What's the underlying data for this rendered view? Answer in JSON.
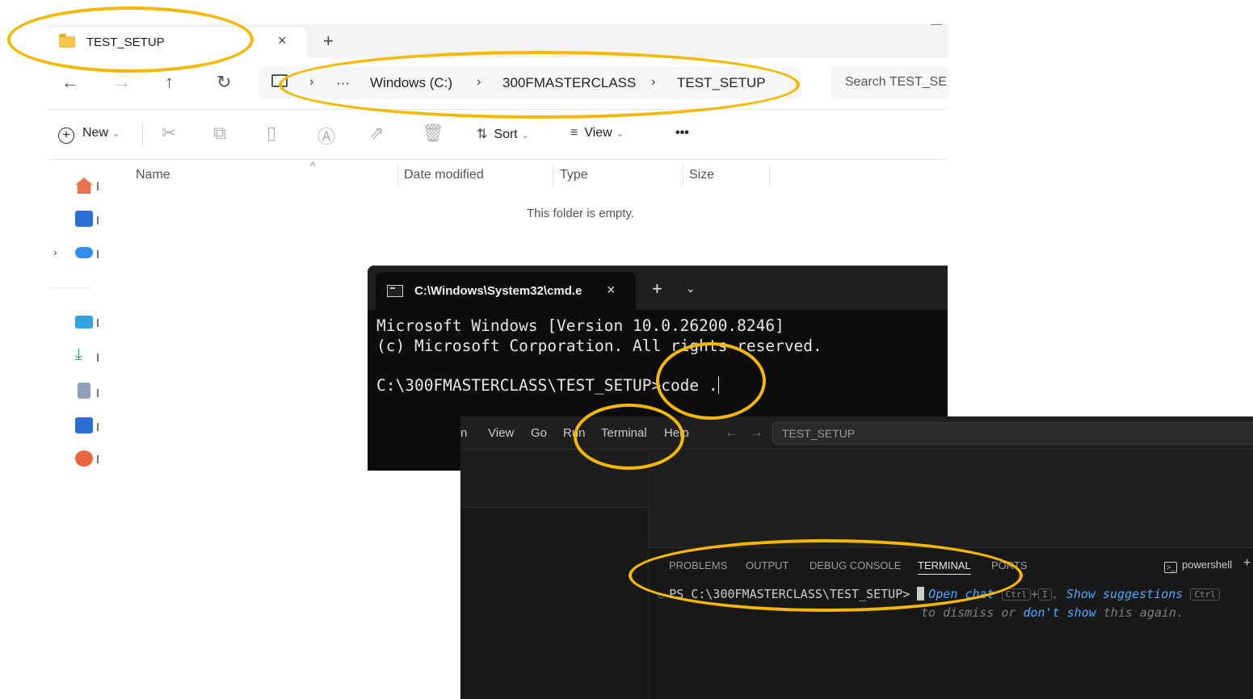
{
  "explorer": {
    "tab_title": "TEST_SETUP",
    "tab_close": "×",
    "new_tab": "+",
    "nav": {
      "back": "←",
      "forward": "→",
      "up": "↑",
      "refresh": "↻"
    },
    "breadcrumb": {
      "overflow": "···",
      "separator": "›",
      "items": [
        "Windows (C:)",
        "300FMASTERCLASS",
        "TEST_SETUP"
      ]
    },
    "search_placeholder": "Search TEST_SE",
    "commands": {
      "new_label": "New",
      "sort_label": "Sort",
      "view_label": "View",
      "more": "•••",
      "icons": [
        "cut-icon",
        "copy-icon",
        "paste-icon",
        "rename-icon",
        "share-icon",
        "delete-icon"
      ]
    },
    "columns": [
      "Name",
      "Date modified",
      "Type",
      "Size"
    ],
    "empty_message": "This folder is empty."
  },
  "cmd": {
    "tab_title": "C:\\Windows\\System32\\cmd.e",
    "tab_close": "×",
    "new_tab": "+",
    "dropdown": "⌄",
    "lines": [
      "Microsoft Windows [Version 10.0.26200.8246]",
      "(c) Microsoft Corporation. All rights reserved.",
      "C:\\300FMASTERCLASS\\TEST_SETUP>code ."
    ]
  },
  "vscode": {
    "menu": [
      "n",
      "View",
      "Go",
      "Run",
      "Terminal",
      "Help"
    ],
    "nav": {
      "back": "←",
      "forward": "→"
    },
    "command_center": "TEST_SETUP",
    "panel_tabs": [
      "PROBLEMS",
      "OUTPUT",
      "DEBUG CONSOLE",
      "TERMINAL",
      "PORTS"
    ],
    "shell_label": "powershell",
    "shell_plus": "+",
    "prompt": "PS C:\\300FMASTERCLASS\\TEST_SETUP>",
    "hint": {
      "open_chat": "Open chat",
      "ctrl": "Ctrl",
      "plus": "+",
      "key_i": "I",
      "period": ".",
      "show_suggestions": "Show suggestions",
      "line2_prefix": "to dismiss or",
      "dont_show": "don't show",
      "line2_suffix": "this again."
    }
  },
  "colors": {
    "annotation": "#f5b800",
    "folder": "#f4c54a",
    "link": "#4daafc"
  }
}
